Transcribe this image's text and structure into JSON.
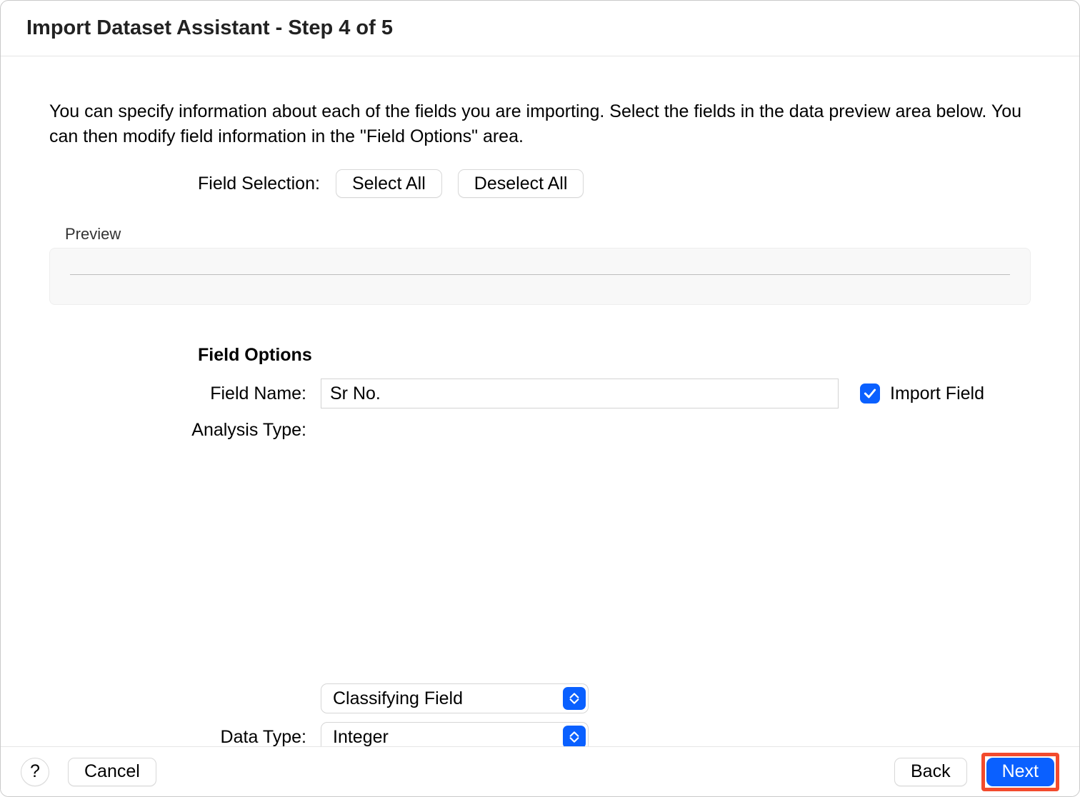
{
  "title": "Import Dataset Assistant - Step 4 of 5",
  "intro": "You can specify information about each of the fields you are importing. Select the fields in the data preview area below. You can then modify field information in the \"Field Options\" area.",
  "selection": {
    "label": "Field Selection:",
    "select_all": "Select All",
    "deselect_all": "Deselect All"
  },
  "preview": {
    "label": "Preview"
  },
  "field_options": {
    "heading": "Field Options",
    "field_name_label": "Field Name:",
    "field_name_value": "Sr No.",
    "import_field_label": "Import Field",
    "import_field_checked": true,
    "analysis_type_label": "Analysis Type:",
    "analysis_value": "Classifying Field",
    "data_type_label": "Data Type:",
    "data_type_value": "Integer"
  },
  "footer": {
    "help": "?",
    "cancel": "Cancel",
    "back": "Back",
    "next": "Next"
  }
}
